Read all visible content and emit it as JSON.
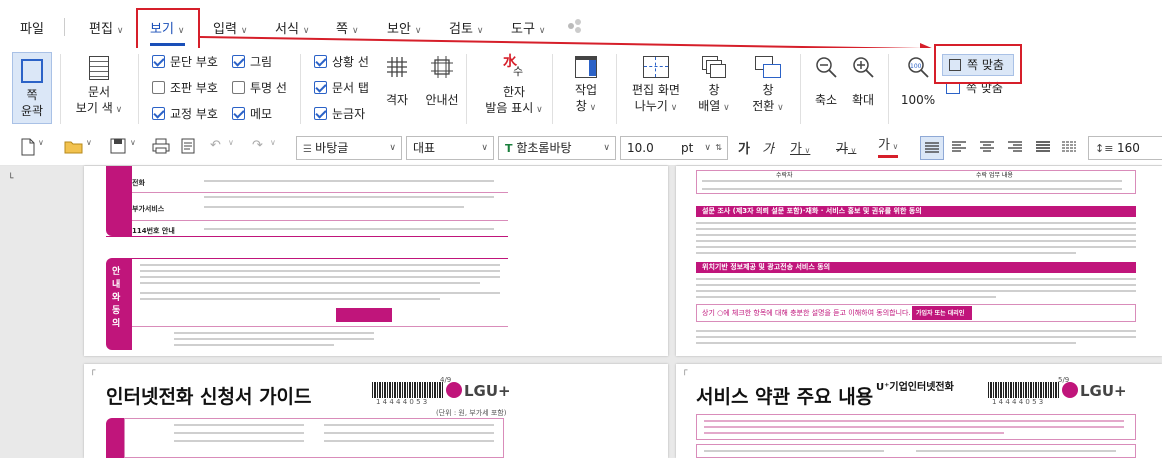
{
  "menubar": {
    "items": [
      "파일",
      "편집",
      "보기",
      "입력",
      "서식",
      "쪽",
      "보안",
      "검토",
      "도구"
    ],
    "active": "보기"
  },
  "ribbon": {
    "page_outline": "쪽\n윤곽",
    "doc_view_color": [
      "문서",
      "보기 색"
    ],
    "checks_col1": [
      {
        "label": "문단 부호",
        "checked": true
      },
      {
        "label": "조판 부호",
        "checked": false
      },
      {
        "label": "교정 부호",
        "checked": true
      }
    ],
    "checks_col2": [
      {
        "label": "그림",
        "checked": true
      },
      {
        "label": "투명 선",
        "checked": false
      },
      {
        "label": "메모",
        "checked": true
      }
    ],
    "checks_col3": [
      {
        "label": "상황 선",
        "checked": true
      },
      {
        "label": "문서 탭",
        "checked": true
      },
      {
        "label": "눈금자",
        "checked": true
      }
    ],
    "grid": "격자",
    "guide_lines": "안내선",
    "hanja": [
      "한자",
      "발음 표시"
    ],
    "work_window": [
      "작업",
      "창"
    ],
    "split_screen": [
      "편집 화면",
      "나누기"
    ],
    "arrange_window": [
      "창",
      "배열"
    ],
    "switch_window": [
      "창",
      "전환"
    ],
    "zoom_out": "축소",
    "zoom_in": "확대",
    "zoom_100": "100%",
    "fit_page": "쪽 맞춤",
    "fit_page2": "쪽 맞춤"
  },
  "toolbar2": {
    "style_font": "바탕글",
    "lang": "대표",
    "font_name": "함초롬바탕",
    "font_size": "10.0",
    "font_unit": "pt",
    "bold": "가",
    "italic": "가",
    "underline": "가",
    "strike": "가",
    "color_char": "가",
    "line_spacing": "160"
  },
  "pages": {
    "top_left": {
      "rows": [
        "전화",
        "부가서비스",
        "114번호 안내"
      ],
      "side_label": "안내와 동의"
    },
    "top_right": {
      "header_cells": [
        "수락자",
        "수락 업무 내용"
      ],
      "section1": "설문 조사 (제3자 의뢰 설문 포함)·재화 · 서비스 홍보 및 권유를 위한 동의",
      "section2": "위치기반 정보제공 및 광고전송 서비스 동의",
      "notice": "상기 ○에 체크한 항목에 대해 충분한 설명을 듣고 이해하여 동의합니다.",
      "sign_label": "가입자 또는 대리인"
    },
    "bottom_left": {
      "title": "인터넷전화 신청서 가이드",
      "page_no": "4/9",
      "unit": "(단위 : 원, 부가세 포함)",
      "barcode_num": "1 4 4 4 4 0 5 3",
      "logo": "LGU+"
    },
    "bottom_right": {
      "title": "서비스 약관 주요 내용",
      "subtitle": "U⁺기업인터넷전화",
      "page_no": "5/9",
      "barcode_num": "1 4 4 4 4 0 5 3",
      "logo": "LGU+"
    }
  },
  "colors": {
    "accent": "#1a4fb8",
    "highlight_red": "#d61f2a",
    "doc_magenta": "#c0157b"
  }
}
